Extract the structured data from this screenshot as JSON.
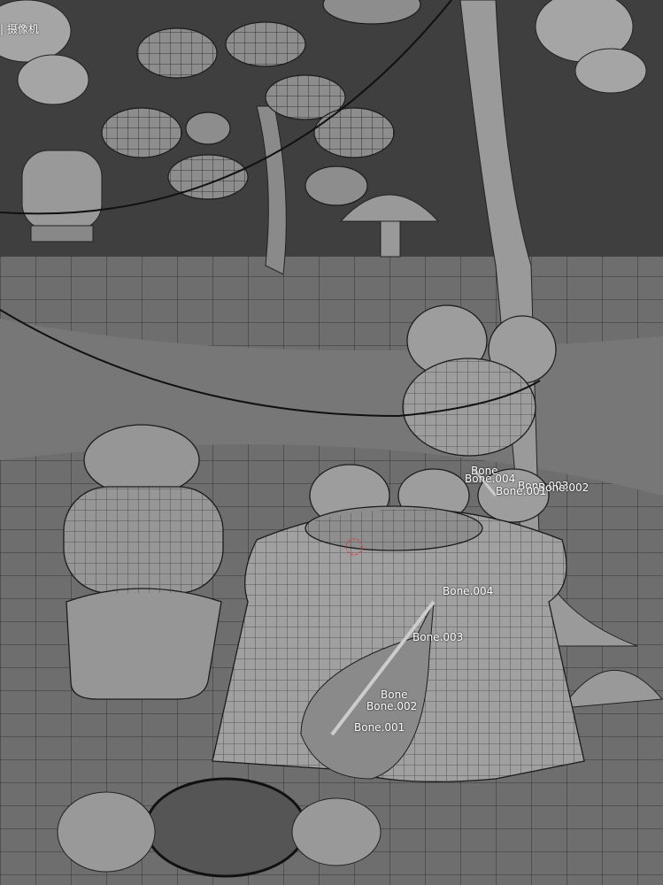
{
  "viewport": {
    "camera_label": "| 摄像机",
    "background": "#3f3f3f",
    "mesh_color": "#8c8c8c",
    "wire_color": "#1a1a1a"
  },
  "bones_upper": [
    "Bone",
    "Bone.004",
    "Bone.003",
    "Bone.002",
    "Bone.001"
  ],
  "bones_lower": [
    "Bone.004",
    "Bone.003",
    "Bone",
    "Bone.002",
    "Bone.001"
  ]
}
